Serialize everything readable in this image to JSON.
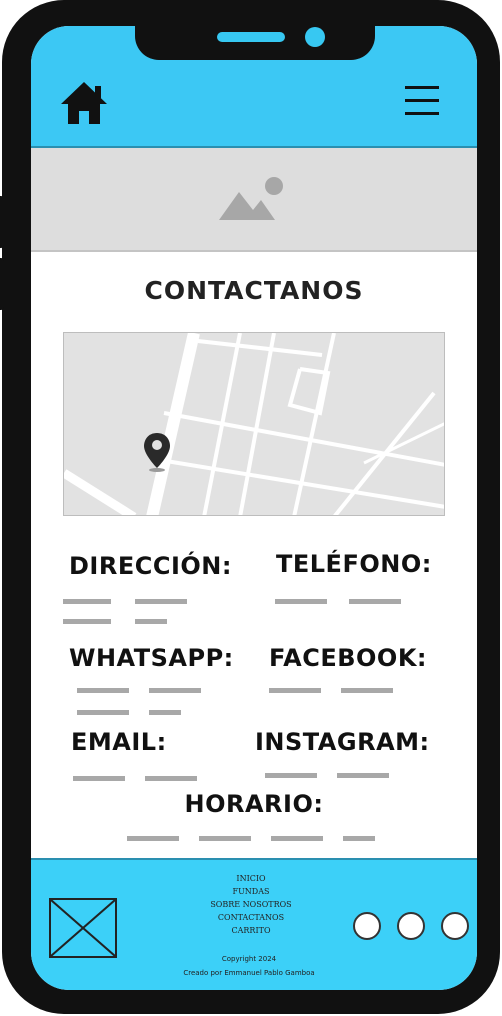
{
  "header": {
    "home_icon": "home-icon",
    "menu_icon": "hamburger-menu-icon",
    "accent_color": "#3cc8f4"
  },
  "hero": {
    "image_icon": "image-placeholder-icon"
  },
  "page": {
    "title": "CONTACTANOS"
  },
  "map": {
    "marker_icon": "map-pin-icon"
  },
  "contact": {
    "direccion_label": "DIRECCIÓN:",
    "telefono_label": "TELÉFONO:",
    "whatsapp_label": "WHATSAPP:",
    "facebook_label": "FACEBOOK:",
    "email_label": "EMAIL:",
    "instagram_label": "INSTAGRAM:",
    "horario_label": "HORARIO:"
  },
  "footer": {
    "links": [
      "INICIO",
      "FUNDAS",
      "SOBRE NOSOTROS",
      "CONTACTANOS",
      "CARRITO"
    ],
    "copyright_line1": "Copyright 2024",
    "copyright_line2": "Creado por Emmanuel Pablo Gamboa",
    "logo_icon": "logo-placeholder-icon",
    "social_icons": [
      "social-icon-1",
      "social-icon-2",
      "social-icon-3"
    ],
    "background_color": "#3cd0f8"
  }
}
